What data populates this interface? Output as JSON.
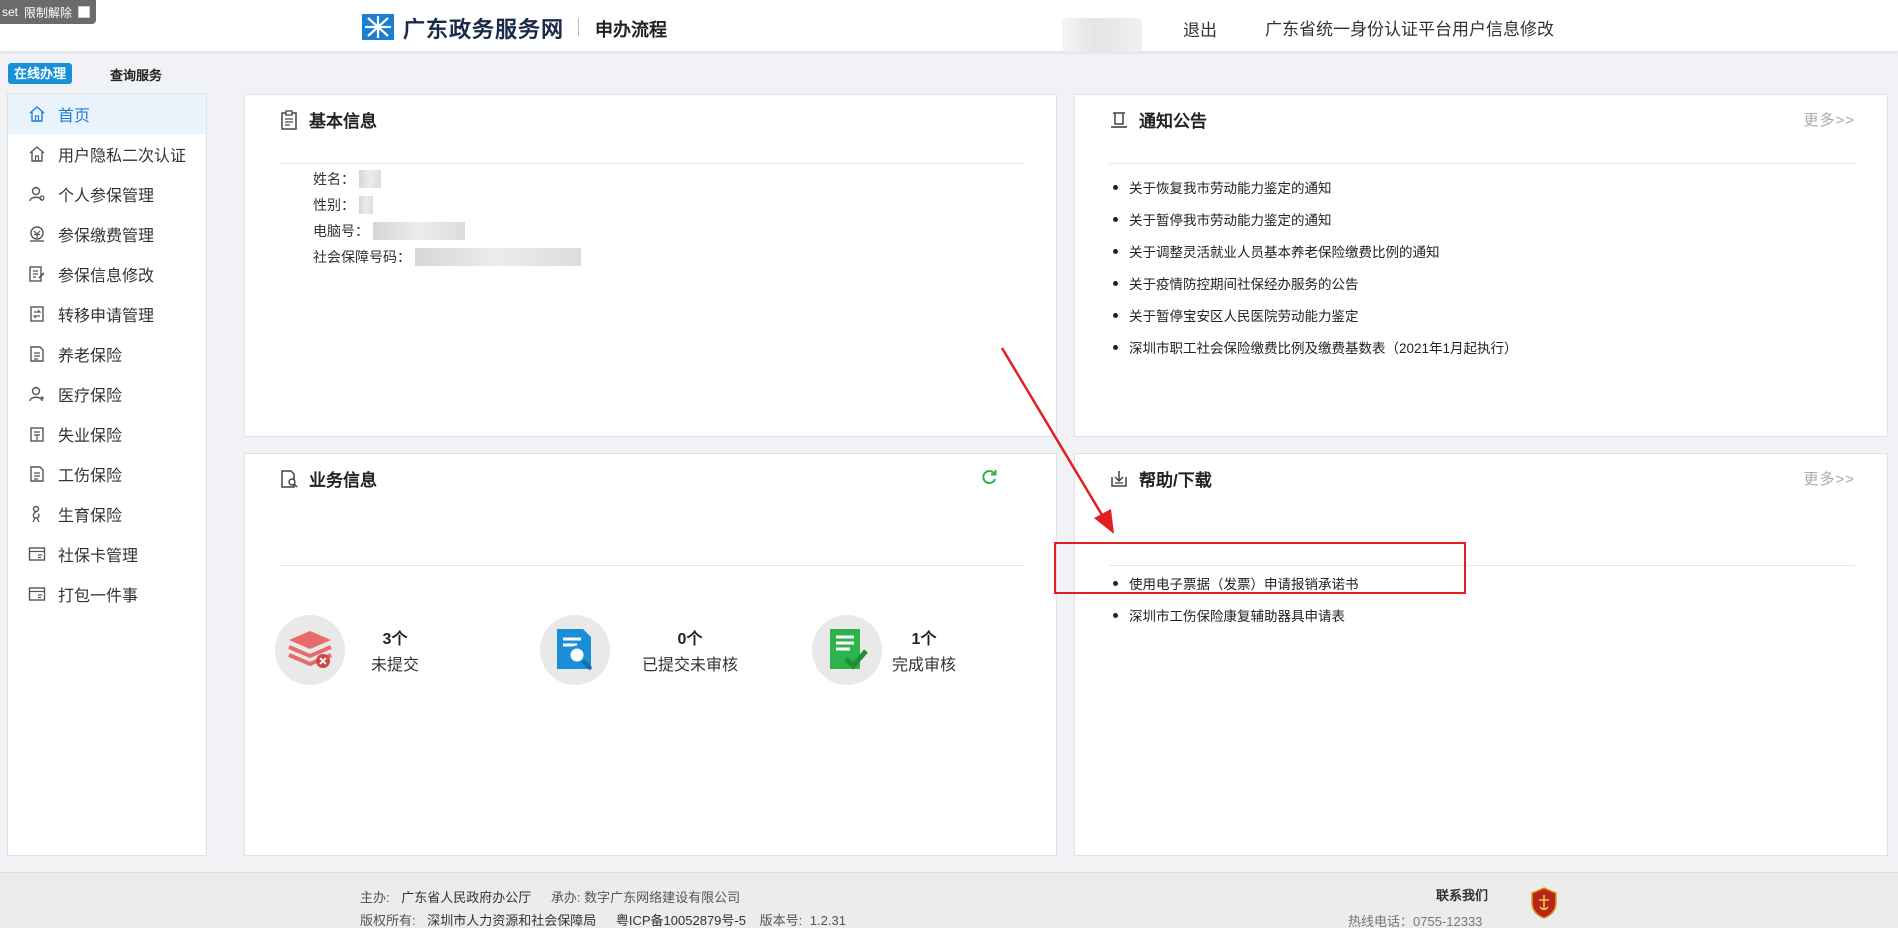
{
  "extension": {
    "prefix": "set",
    "label": "限制解除"
  },
  "header": {
    "brand": "广东政务服务网",
    "subtitle": "申办流程",
    "logout": "退出",
    "id_platform_link": "广东省统一身份认证平台用户信息修改"
  },
  "top_tabs": {
    "online": "在线办理",
    "query": "查询服务"
  },
  "sidebar": {
    "items": [
      {
        "label": "首页",
        "icon": "home-icon"
      },
      {
        "label": "用户隐私二次认证",
        "icon": "home-icon"
      },
      {
        "label": "个人参保管理",
        "icon": "user-icon"
      },
      {
        "label": "参保缴费管理",
        "icon": "payment-icon"
      },
      {
        "label": "参保信息修改",
        "icon": "edit-doc-icon"
      },
      {
        "label": "转移申请管理",
        "icon": "transfer-icon"
      },
      {
        "label": "养老保险",
        "icon": "document-icon"
      },
      {
        "label": "医疗保险",
        "icon": "medical-user-icon"
      },
      {
        "label": "失业保险",
        "icon": "building-icon"
      },
      {
        "label": "工伤保险",
        "icon": "document-icon"
      },
      {
        "label": "生育保险",
        "icon": "maternity-icon"
      },
      {
        "label": "社保卡管理",
        "icon": "card-icon"
      },
      {
        "label": "打包一件事",
        "icon": "card-icon"
      }
    ]
  },
  "basic_info": {
    "title": "基本信息",
    "fields": [
      {
        "label": "姓名："
      },
      {
        "label": "性别："
      },
      {
        "label": "电脑号："
      },
      {
        "label": "社会保障号码："
      }
    ]
  },
  "notice": {
    "title": "通知公告",
    "more": "更多>>",
    "items": [
      "关于恢复我市劳动能力鉴定的通知",
      "关于暂停我市劳动能力鉴定的通知",
      "关于调整灵活就业人员基本养老保险缴费比例的通知",
      "关于疫情防控期间社保经办服务的公告",
      "关于暂停宝安区人民医院劳动能力鉴定",
      "深圳市职工社会保险缴费比例及缴费基数表（2021年1月起执行）"
    ]
  },
  "business": {
    "title": "业务信息",
    "stats": [
      {
        "count": "3个",
        "label": "未提交",
        "icon": "stack-icon",
        "color": "#e86a6a"
      },
      {
        "count": "0个",
        "label": "已提交未审核",
        "icon": "doc-search-icon",
        "color": "#1a8fd8"
      },
      {
        "count": "1个",
        "label": "完成审核",
        "icon": "doc-check-icon",
        "color": "#2cb34a"
      }
    ]
  },
  "help": {
    "title": "帮助/下载",
    "more": "更多>>",
    "items": [
      "使用电子票据（发票）申请报销承诺书",
      "深圳市工伤保险康复辅助器具申请表"
    ]
  },
  "footer": {
    "host_label": "主办:",
    "host": "广东省人民政府办公厅",
    "undertake_label": "承办:",
    "undertake": "数字广东网络建设有限公司",
    "copyright_label": "版权所有:",
    "copyright": "深圳市人力资源和社会保障局",
    "icp": "粤ICP备10052879号-5",
    "version_label": "版本号:",
    "version": "1.2.31",
    "contact": "联系我们",
    "hotline": "热线电话：0755-12333"
  },
  "colors": {
    "accent": "#1890d8",
    "annotation": "#e02020"
  }
}
